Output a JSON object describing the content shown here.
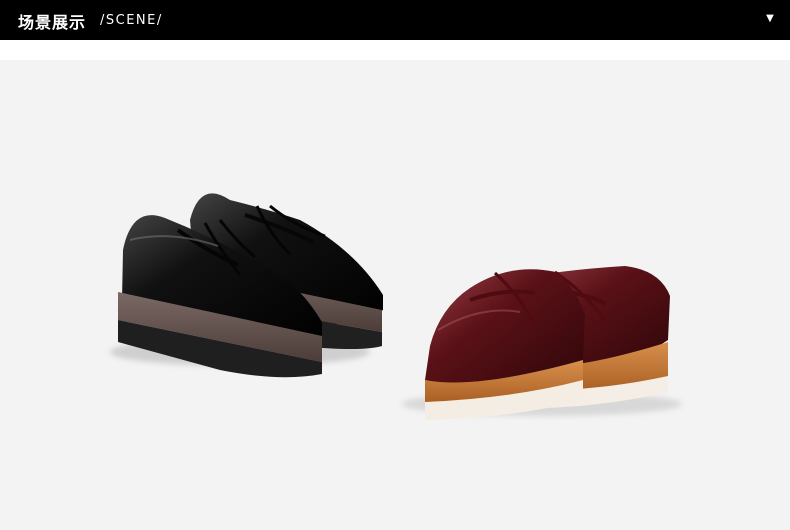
{
  "header": {
    "title": "场景展示",
    "subtitle": "/SCENE/",
    "toggle_icon": "caret-down-icon"
  },
  "scene": {
    "items": [
      {
        "name": "black-platform-oxford-shoes",
        "upper_color": "#0f0f10",
        "sole_color": "#5b4a45",
        "outsole_color": "#1d1d1d"
      },
      {
        "name": "burgundy-platform-oxford-shoes",
        "upper_color": "#5d1216",
        "sole_color": "#b86f2c",
        "outsole_color": "#f4eee6"
      }
    ]
  }
}
